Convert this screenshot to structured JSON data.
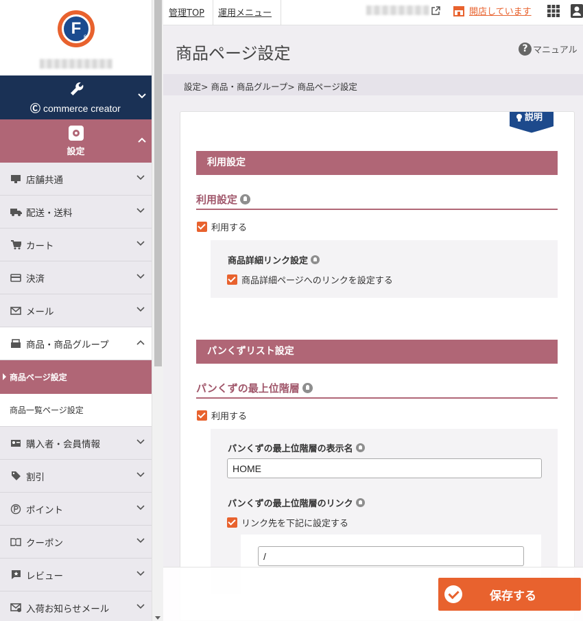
{
  "brand": {
    "logo_letter": "F",
    "logo_mark": "®"
  },
  "sidebar": {
    "commerce_creator": "commerce creator",
    "settings_label": "設定",
    "items": [
      {
        "label": "店舗共通",
        "icon": "monitor-icon"
      },
      {
        "label": "配送・送料",
        "icon": "truck-icon"
      },
      {
        "label": "カート",
        "icon": "cart-icon"
      },
      {
        "label": "決済",
        "icon": "credit-card-icon"
      },
      {
        "label": "メール",
        "icon": "mail-icon"
      },
      {
        "label": "商品・商品グループ",
        "icon": "product-icon"
      },
      {
        "label": "購入者・会員情報",
        "icon": "member-card-icon"
      },
      {
        "label": "割引",
        "icon": "tag-icon"
      },
      {
        "label": "ポイント",
        "icon": "point-icon"
      },
      {
        "label": "クーポン",
        "icon": "coupon-icon"
      },
      {
        "label": "レビュー",
        "icon": "review-icon"
      },
      {
        "label": "入荷お知らせメール",
        "icon": "arrival-mail-icon"
      }
    ],
    "sub_items": [
      {
        "label": "商品ページ設定",
        "active": true
      },
      {
        "label": "商品一覧ページ設定",
        "active": false
      }
    ]
  },
  "topbar": {
    "admin_top": "管理TOP",
    "operation_menu": "運用メニュー",
    "store_status": "開店しています"
  },
  "header": {
    "title": "商品ページ設定",
    "manual": "マニュアル",
    "breadcrumb": "設定> 商品・商品グループ> 商品ページ設定"
  },
  "content": {
    "explain_badge": "説明",
    "usage_section": {
      "title": "利用設定",
      "subtitle": "利用設定",
      "use_checkbox": "利用する",
      "detail_link_label": "商品詳細リンク設定",
      "detail_link_checkbox": "商品詳細ページへのリンクを設定する"
    },
    "breadcrumb_section": {
      "title": "パンくずリスト設定",
      "subtitle": "パンくずの最上位階層",
      "use_checkbox": "利用する",
      "display_name_label": "パンくずの最上位階層の表示名",
      "display_name_value": "HOME",
      "link_label": "パンくずの最上位階層のリンク",
      "link_checkbox": "リンク先を下記に設定する",
      "link_value": "/"
    }
  },
  "save_button": "保存する",
  "colors": {
    "accent": "#b06676",
    "action": "#e8622e",
    "navy": "#1a3155"
  }
}
